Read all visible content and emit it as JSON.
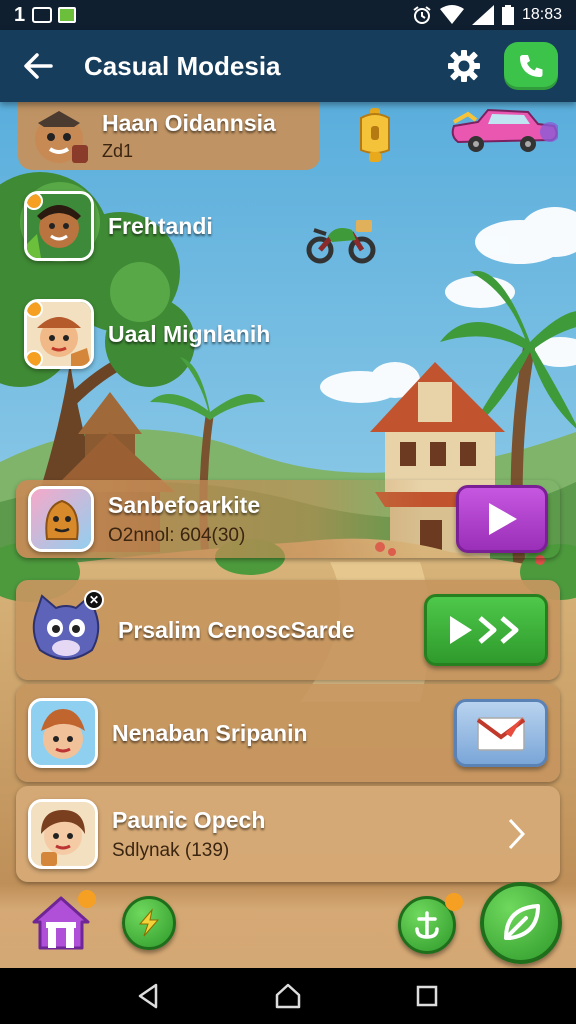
{
  "status_bar": {
    "left_number": "1",
    "time": "18:83",
    "icons": [
      "alarm-icon",
      "wifi-icon",
      "signal-icon",
      "battery-icon"
    ]
  },
  "app_bar": {
    "title": "Casual Modesia",
    "back_icon": "arrow-left-icon",
    "settings_icon": "gear-icon",
    "call_icon": "phone-icon",
    "call_color": "#3cc34a"
  },
  "floaters": [
    "bell-icon",
    "pink-car-icon",
    "motorbike-icon"
  ],
  "rows": [
    {
      "name": "Haan Oidannsia",
      "sub": "Zd1",
      "avatar": "bear-avatar"
    },
    {
      "name": "Frehtandi",
      "sub": "",
      "avatar": "tribal-avatar"
    },
    {
      "name": "Uaal Mignlanih",
      "sub": "",
      "avatar": "hat-girl-avatar"
    },
    {
      "name": "Sanbefoarkite",
      "sub": "O2nnol: 604(30)",
      "avatar": "blob-avatar",
      "action": "play-button",
      "action_color": "#b73fd1"
    },
    {
      "name": "Prsalim CenoscSarde",
      "sub": "",
      "avatar": "cat-avatar",
      "action": "fast-forward-button",
      "action_color": "#3fb33b"
    },
    {
      "name": "Nenaban Sripanin",
      "sub": "",
      "avatar": "boy-avatar",
      "action": "mail-button",
      "action_color": "#7aa6d8"
    },
    {
      "name": "Paunic Opech",
      "sub": "Sdlynak (139)",
      "avatar": "girl-avatar",
      "action": "chevron-right"
    }
  ],
  "bottom_actions": [
    "home-icon",
    "lightning-icon",
    "anchor-icon",
    "leaf-icon"
  ],
  "accent_orange": "#f5a023"
}
